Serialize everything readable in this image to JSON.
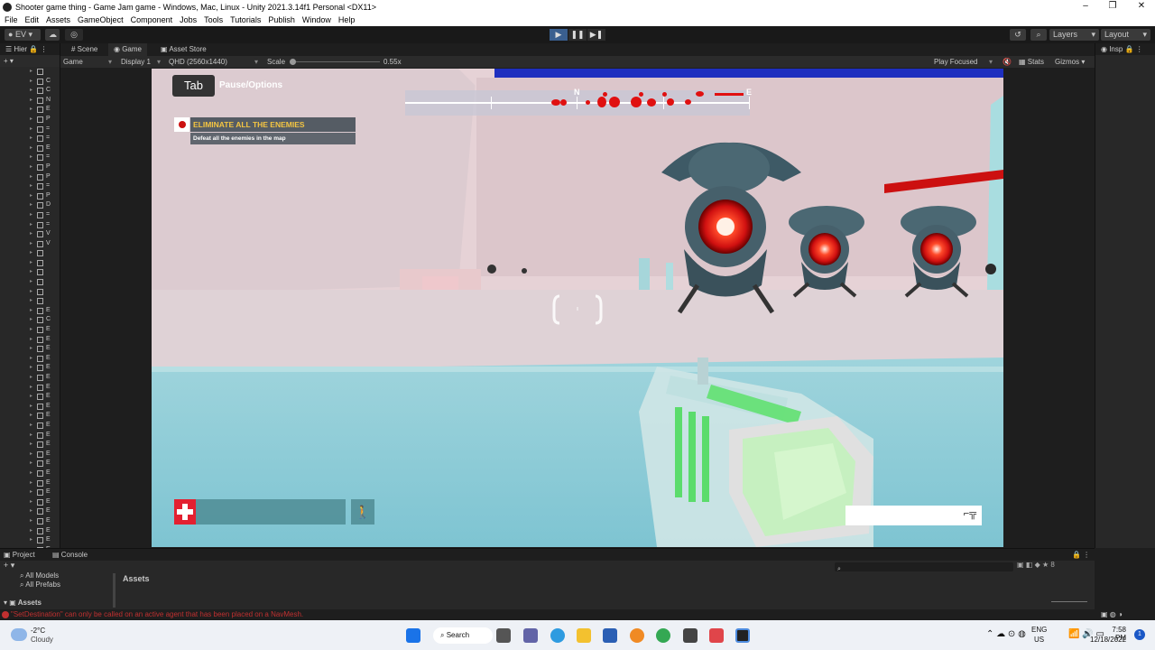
{
  "window": {
    "title": "Shooter game thing - Game Jam game - Windows, Mac, Linux - Unity 2021.3.14f1 Personal <DX11>",
    "controls": [
      "–",
      "❐",
      "✕"
    ]
  },
  "menu": [
    "File",
    "Edit",
    "Assets",
    "GameObject",
    "Component",
    "Jobs",
    "Tools",
    "Tutorials",
    "Publish",
    "Window",
    "Help"
  ],
  "toolbar": {
    "account": "EV",
    "layers": "Layers",
    "layout": "Layout"
  },
  "hierarchy": {
    "tab": "Hier",
    "rows": [
      "",
      "C",
      "C",
      "N",
      "E",
      "P",
      "=",
      "=",
      "E",
      "=",
      "P",
      "P",
      "=",
      "P",
      "D",
      "=",
      "=",
      "V",
      "V",
      "",
      "",
      "",
      "",
      "",
      "",
      "E",
      "C",
      "E",
      "E",
      "E",
      "E",
      "E",
      "E",
      "E",
      "E",
      "E",
      "E",
      "E",
      "E",
      "E",
      "E",
      "E",
      "E",
      "E",
      "E",
      "E",
      "E",
      "E",
      "E",
      "E",
      "E",
      "E"
    ]
  },
  "game_panel": {
    "tabs": [
      "Scene",
      "Game",
      "Asset Store"
    ],
    "mode": "Game",
    "display": "Display 1",
    "resolution": "QHD (2560x1440)",
    "scale_label": "Scale",
    "scale_value": "0.55x",
    "play_focused": "Play Focused",
    "stats": "Stats",
    "gizmos": "Gizmos"
  },
  "hud": {
    "tab_key": "Tab",
    "pause_label": "Pause/Options",
    "objective_title": "ELIMINATE ALL THE ENEMIES",
    "objective_desc": "Defeat all the enemies in the map",
    "compass_n": "N",
    "compass_e": "E"
  },
  "inspector": {
    "tab": "Insp"
  },
  "project": {
    "tabs": [
      "Project",
      "Console"
    ],
    "favorites": [
      "All Models",
      "All Prefabs"
    ],
    "assets_header": "Assets",
    "assets_root": "Assets",
    "count": "8"
  },
  "console": {
    "message": "\"SetDestination\" can only be called on an active agent that has been placed on a NavMesh."
  },
  "taskbar": {
    "weather_temp": "-2°C",
    "weather_desc": "Cloudy",
    "search": "Search",
    "lang": "ENG",
    "region": "US",
    "time": "7:58 PM",
    "date": "12/18/2022",
    "notif_count": "1"
  },
  "colors": {
    "accent": "#4e8cdf",
    "enemy_red": "#ff2a1a",
    "objective_yellow": "#f4c542",
    "error_red": "#c03030"
  }
}
